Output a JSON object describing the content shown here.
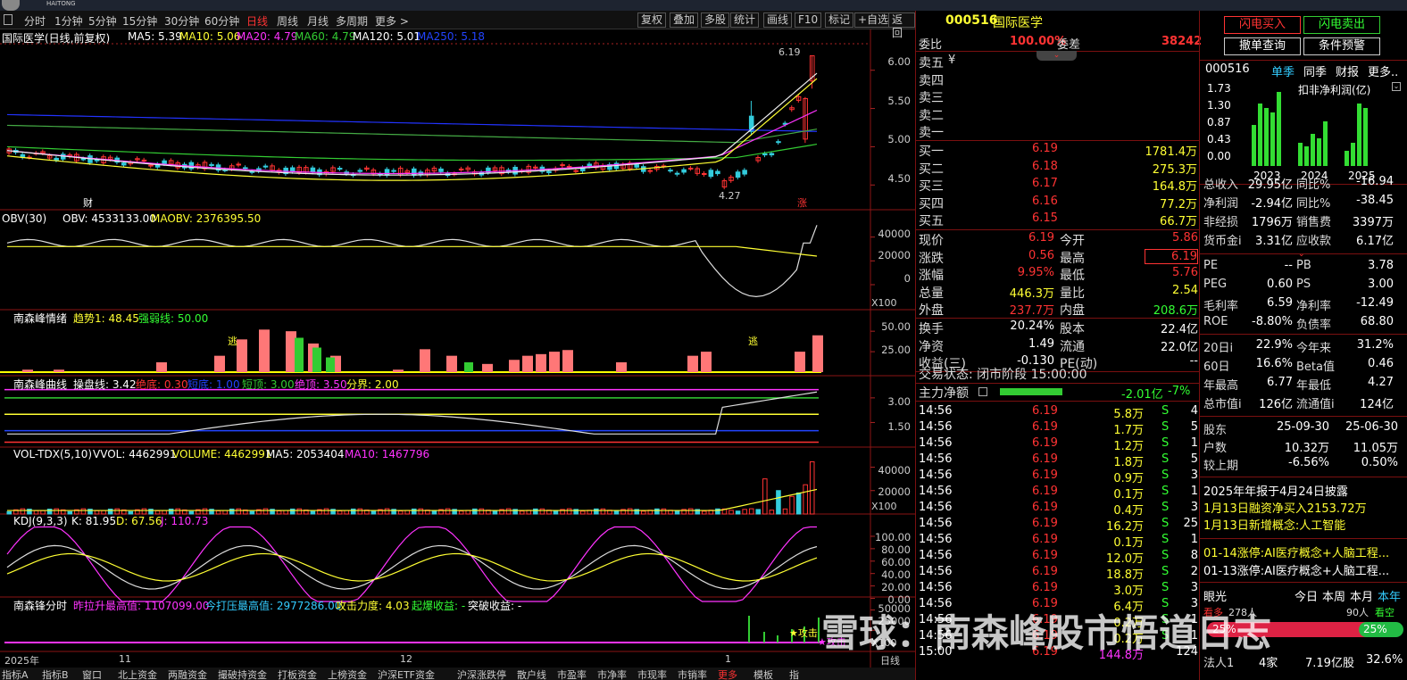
{
  "topbar": {
    "logo": "HAITONG"
  },
  "period": {
    "items": [
      "分时",
      "1分钟",
      "5分钟",
      "15分钟",
      "30分钟",
      "60分钟",
      "日线",
      "周线",
      "月线",
      "多周期",
      "更多 >"
    ],
    "active": "日线"
  },
  "tools": [
    "复权",
    "叠加",
    "多股",
    "统计",
    "画线",
    "F10",
    "标记",
    "+自选",
    "返回"
  ],
  "main": {
    "title": "国际医学(日线,前复权)",
    "ma5": "MA5: 5.39",
    "ma10": "MA10: 5.06",
    "ma20": "MA20: 4.79",
    "ma60": "MA60: 4.79",
    "ma120": "MA120: 5.01",
    "ma250": "MA250: 5.18",
    "high_label": "6.19",
    "low_label": "4.27",
    "yticks": [
      "6.00",
      "5.50",
      "5.00",
      "4.50"
    ],
    "cai": "财",
    "zhang": "涨"
  },
  "obv": {
    "title": "OBV(30)",
    "obv": "OBV: 4533133.00",
    "maobv": "MAOBV: 2376395.50",
    "yticks": [
      "40000",
      "20000",
      "0"
    ],
    "unit": "X100"
  },
  "emo": {
    "title": "南森峰情绪",
    "trend": "趋势1: 48.45",
    "strong": "强弱线: 50.00",
    "yticks": [
      "50.00",
      "25.00"
    ],
    "tao": "逃"
  },
  "curve": {
    "title": "南森峰曲线",
    "cao": "操盘线: 3.42",
    "judi": "绝底: 0.30",
    "duandi": "短底: 1.00",
    "duanding": "短顶: 3.00",
    "jueding": "绝顶: 3.50",
    "fenjie": "分界: 2.00",
    "yticks": [
      "3.00",
      "1.50"
    ]
  },
  "vol": {
    "title": "VOL-TDX(5,10)",
    "vvol": "VVOL: 4462991",
    "volume": "VOLUME: 4462991",
    "ma5": "MA5: 2053404",
    "ma10": "MA10: 1467796",
    "yticks": [
      "40000",
      "20000"
    ],
    "unit": "X100"
  },
  "kdj": {
    "title": "KDJ(9,3,3)",
    "k": "K: 81.95",
    "d": "D: 67.56",
    "j": "J: 110.73",
    "yticks": [
      "100.00",
      "80.00",
      "60.00",
      "40.00",
      "20.00",
      "0.00"
    ]
  },
  "fenshi": {
    "title": "南森锋分时",
    "lasheng": "昨拉升最高值: 1107099.00",
    "daya": "今打压最高值: 2977286.00",
    "gongji": "攻击力度: 4.03",
    "qibao": "起爆收益: -",
    "tupo": "突破收益: -",
    "yticks": [
      "50000",
      "25000"
    ],
    "unit": "X100",
    "attack": "★攻击",
    "attack2": "★攻击"
  },
  "xaxis": {
    "labels": [
      "2025年",
      "11",
      "12",
      "1"
    ],
    "daily": "日线"
  },
  "bottom_tabs": [
    "指标A",
    "指标B",
    "窗口",
    "北上资金",
    "两融资金",
    "撮破持资金",
    "打板资金",
    "上榜资金",
    "沪深ETF资金",
    "沪深涨跌停",
    "散户线",
    "市盈率",
    "市净率",
    "市现率",
    "市销率",
    "更多",
    "模板",
    "指"
  ],
  "quote": {
    "code": "000516",
    "name": "国际医学",
    "weibi_l": "委比",
    "weibi": "100.00%",
    "weicha_l": "委差",
    "weicha": "38242",
    "sells": [
      {
        "l": "卖五",
        "p": "¥"
      },
      {
        "l": "卖四",
        "p": ""
      },
      {
        "l": "卖三",
        "p": ""
      },
      {
        "l": "卖二",
        "p": ""
      },
      {
        "l": "卖一",
        "p": ""
      }
    ],
    "buys": [
      {
        "l": "买一",
        "p": "6.19",
        "v": "1781.4万"
      },
      {
        "l": "买二",
        "p": "6.18",
        "v": "275.3万"
      },
      {
        "l": "买三",
        "p": "6.17",
        "v": "164.8万"
      },
      {
        "l": "买四",
        "p": "6.16",
        "v": "77.2万"
      },
      {
        "l": "买五",
        "p": "6.15",
        "v": "66.7万"
      }
    ],
    "stats": [
      [
        "现价",
        "6.19",
        "今开",
        "5.86"
      ],
      [
        "涨跌",
        "0.56",
        "最高",
        "6.19"
      ],
      [
        "涨幅",
        "9.95%",
        "最低",
        "5.76"
      ],
      [
        "总量",
        "446.3万",
        "量比",
        "2.54"
      ],
      [
        "外盘",
        "237.7万",
        "内盘",
        "208.6万"
      ]
    ],
    "stats2": [
      [
        "换手",
        "20.24%",
        "股本",
        "22.4亿"
      ],
      [
        "净资",
        "1.49",
        "流通",
        "22.0亿"
      ],
      [
        "收益(三)",
        "-0.130",
        "PE(动)",
        "--"
      ]
    ],
    "status": "交易状态: 闭市阶段 15:00:00",
    "zhuli_l": "主力净额",
    "zhuli": "-2.01亿",
    "zhuli_pct": "-7%",
    "ticks": [
      [
        "14:56",
        "6.19",
        "5.8万",
        "S",
        "4"
      ],
      [
        "14:56",
        "6.19",
        "1.7万",
        "S",
        "5"
      ],
      [
        "14:56",
        "6.19",
        "1.2万",
        "S",
        "1"
      ],
      [
        "14:56",
        "6.19",
        "1.8万",
        "S",
        "5"
      ],
      [
        "14:56",
        "6.19",
        "0.9万",
        "S",
        "3"
      ],
      [
        "14:56",
        "6.19",
        "0.1万",
        "S",
        "1"
      ],
      [
        "14:56",
        "6.19",
        "0.4万",
        "S",
        "3"
      ],
      [
        "14:56",
        "6.19",
        "16.2万",
        "S",
        "25"
      ],
      [
        "14:56",
        "6.19",
        "0.1万",
        "S",
        "1"
      ],
      [
        "14:56",
        "6.19",
        "12.0万",
        "S",
        "8"
      ],
      [
        "14:56",
        "6.19",
        "18.8万",
        "S",
        "2"
      ],
      [
        "14:56",
        "6.19",
        "3.0万",
        "S",
        "3"
      ],
      [
        "14:56",
        "6.19",
        "6.4万",
        "S",
        "3"
      ],
      [
        "14:56",
        "6.19",
        "0.2万",
        "S",
        "1"
      ],
      [
        "14:56",
        "6.19",
        "0.2万",
        "S",
        "1"
      ],
      [
        "15:00",
        "6.19",
        "144.8万",
        "",
        "124"
      ]
    ]
  },
  "fin": {
    "btn1": "闪电买入",
    "btn2": "闪电卖出",
    "btn3": "撤单查询",
    "btn4": "条件预警",
    "code": "000516",
    "tabs": [
      "单季",
      "同季",
      "财报",
      "更多.."
    ],
    "chart_title": "扣非净利润(亿)",
    "yticks": [
      "1.73",
      "1.30",
      "0.87",
      "0.43",
      "0.00"
    ],
    "years": [
      "2023",
      "2024",
      "2025"
    ],
    "rows1": [
      [
        "总收入",
        "29.95亿",
        "同比%",
        "-16.94"
      ],
      [
        "净利润",
        "-2.94亿",
        "同比%",
        "-38.45"
      ],
      [
        "非经损",
        "1796万",
        "销售费",
        "3397万"
      ],
      [
        "货币金i",
        "3.31亿",
        "应收款",
        "6.17亿"
      ]
    ],
    "rows2": [
      [
        "PE",
        "--",
        "PB",
        "3.78"
      ],
      [
        "PEG",
        "0.60",
        "PS",
        "3.00"
      ],
      [
        "毛利率",
        "6.59",
        "净利率",
        "-12.49"
      ],
      [
        "ROE",
        "-8.80%",
        "负债率",
        "68.80"
      ]
    ],
    "rows3": [
      [
        "20日i",
        "22.9%",
        "今年来",
        "31.2%"
      ],
      [
        "60日",
        "16.6%",
        "Beta值",
        "0.46"
      ],
      [
        "年最高",
        "6.77",
        "年最低",
        "4.27"
      ],
      [
        "总市值i",
        "126亿",
        "流通值i",
        "124亿"
      ]
    ],
    "rows4": [
      [
        "股东",
        "25-09-30",
        "25-06-30"
      ],
      [
        "户数",
        "10.32万",
        "11.05万"
      ],
      [
        "较上期",
        "-6.56%",
        "0.50%"
      ]
    ],
    "news": [
      "2025年年报于4月24日披露",
      "1月13日融资净买入2153.72万",
      "1月13日新增概念:人工智能"
    ],
    "limits": [
      "01-14涨停:AI医疗概念+人脑工程...",
      "01-13涨停:AI医疗概念+人脑工程..."
    ],
    "eye": "眼光",
    "periods": [
      "今日",
      "本周",
      "本月",
      "本年"
    ],
    "look": "看空",
    "bull": "看多",
    "pct_l": "25%",
    "pct_r": "25%",
    "cnt": "278人",
    "cnt2": "90人",
    "fa": "法人1",
    "fa_v": "4家",
    "fa_v2": "7.19亿股",
    "fa_v3": "32.6%"
  },
  "watermark": "雪球：南森峰股市悟道日志",
  "chart_data": {
    "type": "candlestick",
    "last_close": 6.19,
    "high": 6.19,
    "low": 4.27,
    "ylim": [
      4.2,
      6.3
    ]
  }
}
